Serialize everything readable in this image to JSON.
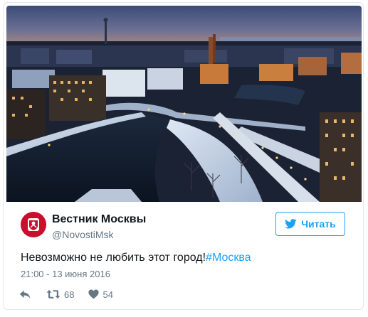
{
  "tweet": {
    "author_name": "Вестник Москвы",
    "author_handle": "@NovostiMsk",
    "text": "Невозможно не любить этот город!",
    "hashtag": "#Москва",
    "timestamp": "21:00 - 13 июня 2016",
    "retweet_count": "68",
    "like_count": "54"
  },
  "follow_button": {
    "label": "Читать",
    "icon": "twitter-bird-icon"
  },
  "media": {
    "icon": "city-night-photo"
  },
  "actions": {
    "reply_icon": "reply-icon",
    "retweet_icon": "retweet-icon",
    "like_icon": "heart-icon"
  },
  "colors": {
    "accent": "#1da1f2",
    "text": "#14171a",
    "muted": "#657786",
    "border": "#e1e8ed",
    "avatar_bg": "#c8102e"
  }
}
